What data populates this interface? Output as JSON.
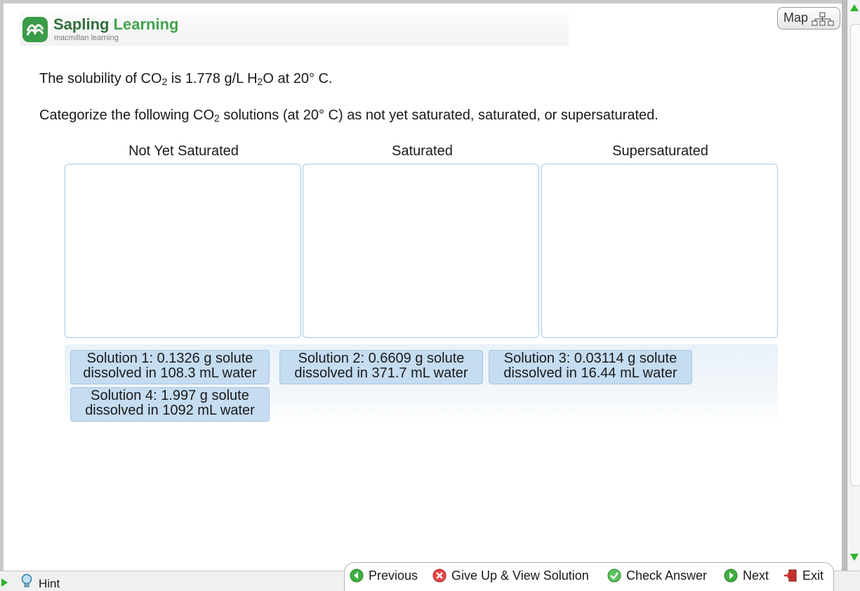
{
  "brand": {
    "name_part1": "Sapling ",
    "name_part2": "Learning",
    "subtitle": "macmillan learning"
  },
  "map_button": {
    "label": "Map"
  },
  "question": {
    "line1": {
      "pre": "The solubility of CO",
      "sub1": "2",
      "mid": " is 1.778 g/L H",
      "sub2": "2",
      "post": "O at 20° C."
    },
    "line2": {
      "pre": "Categorize the following CO",
      "sub": "2",
      "post": " solutions (at 20° C) as not yet saturated, saturated, or supersaturated."
    }
  },
  "categories": [
    "Not Yet Saturated",
    "Saturated",
    "Supersaturated"
  ],
  "solutions": [
    {
      "line1": "Solution 1: 0.1326 g solute",
      "line2": "dissolved in 108.3 mL water"
    },
    {
      "line1": "Solution 2: 0.6609 g solute",
      "line2": "dissolved in 371.7 mL water"
    },
    {
      "line1": "Solution 3: 0.03114 g solute",
      "line2": "dissolved in 16.44 mL water"
    },
    {
      "line1": "Solution 4: 1.997 g solute",
      "line2": "dissolved in 1092 mL water"
    }
  ],
  "footer": {
    "hint": "Hint",
    "previous": "Previous",
    "give_up": "Give Up & View Solution",
    "check_answer": "Check Answer",
    "next": "Next",
    "exit": "Exit"
  },
  "colors": {
    "brand_green": "#3a9b48",
    "chip_blue": "#c5dcf1",
    "bin_border": "#a9c8e6",
    "scroll_arrow": "#2db52d"
  },
  "icons": [
    "sapling-logo-icon",
    "sitemap-icon",
    "lightbulb-icon",
    "previous-arrow-icon",
    "give-up-x-icon",
    "check-icon",
    "next-arrow-icon",
    "exit-door-icon"
  ]
}
